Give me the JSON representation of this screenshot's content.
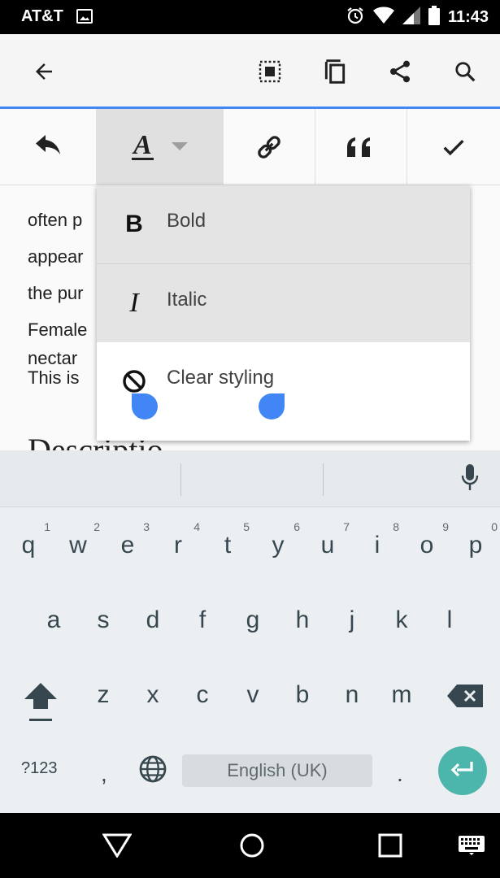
{
  "status_bar": {
    "carrier": "AT&T",
    "time": "11:43",
    "icons": [
      "image-notification-icon",
      "alarm-icon",
      "wifi-icon",
      "signal-icon",
      "battery-icon"
    ]
  },
  "app_bar": {
    "icons": [
      "back-arrow-icon",
      "select-all-icon",
      "copy-icon",
      "share-icon",
      "search-icon"
    ]
  },
  "format_toolbar": {
    "icons": [
      "undo-icon",
      "text-format-icon",
      "link-icon",
      "quote-icon",
      "done-check-icon"
    ],
    "text_format_letter": "A"
  },
  "document": {
    "cut_line": "nectar",
    "lines": [
      "often p",
      "appear",
      "the pur",
      "Female"
    ],
    "paragraph2": "This is",
    "heading_partial": "Descriptio"
  },
  "format_menu": {
    "items": [
      {
        "icon": "bold-icon",
        "glyph": "B",
        "label": "Bold",
        "highlighted": true
      },
      {
        "icon": "italic-icon",
        "glyph": "I",
        "label": "Italic",
        "highlighted": true
      },
      {
        "icon": "clear-styling-icon",
        "label": "Clear styling",
        "highlighted": false
      }
    ]
  },
  "keyboard": {
    "row1": [
      {
        "key": "q",
        "hint": "1"
      },
      {
        "key": "w",
        "hint": "2"
      },
      {
        "key": "e",
        "hint": "3"
      },
      {
        "key": "r",
        "hint": "4"
      },
      {
        "key": "t",
        "hint": "5"
      },
      {
        "key": "y",
        "hint": "6"
      },
      {
        "key": "u",
        "hint": "7"
      },
      {
        "key": "i",
        "hint": "8"
      },
      {
        "key": "o",
        "hint": "9"
      },
      {
        "key": "p",
        "hint": "0"
      }
    ],
    "row2": [
      "a",
      "s",
      "d",
      "f",
      "g",
      "h",
      "j",
      "k",
      "l"
    ],
    "row3": [
      "z",
      "x",
      "c",
      "v",
      "b",
      "n",
      "m"
    ],
    "symbols_key": "?123",
    "comma_key": ",",
    "space_label": "English (UK)",
    "period_key": ".",
    "accent_color": "#4db6ac"
  },
  "nav_bar": {
    "icons": [
      "back-triangle-icon",
      "home-circle-icon",
      "recents-square-icon",
      "keyboard-switch-icon"
    ]
  },
  "colors": {
    "accent_blue": "#4285f4",
    "menu_highlight": "#e4e4e4"
  }
}
